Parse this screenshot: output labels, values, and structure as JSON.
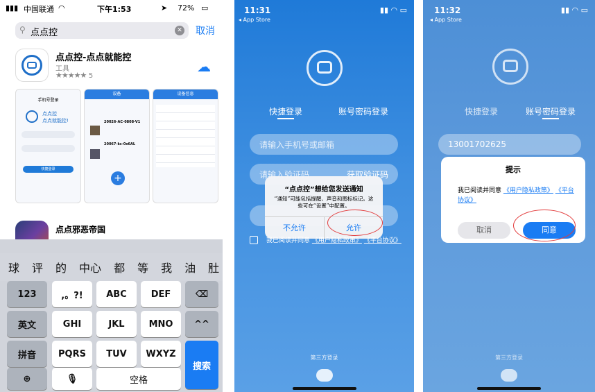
{
  "screen1": {
    "status": {
      "carrier": "中国联通",
      "time": "下午1:53",
      "battery": "72%"
    },
    "search": {
      "query": "点点控",
      "cancel": "取消"
    },
    "app": {
      "name": "点点控-点点就能控",
      "category": "工具",
      "rating_count": "5"
    },
    "app2": {
      "name": "点点邪恶帝国"
    },
    "screenshots": {
      "s1": {
        "title": "手机号登录",
        "logo1": "点点控",
        "logo2": "点点就能控!",
        "button": "快捷登录"
      },
      "s2": {
        "title": "设备",
        "dev1": "20026-AC-0808-V1",
        "dev2": "20067-kc-0x6AL"
      },
      "s3": {
        "title": "设备信息"
      }
    },
    "suggestions": [
      "球",
      "评",
      "的",
      "中心",
      "都",
      "等",
      "我",
      "油",
      "肚"
    ],
    "keys": {
      "r1": [
        "123",
        ",。?!",
        "ABC",
        "DEF"
      ],
      "r2": [
        "英文",
        "GHI",
        "JKL",
        "MNO",
        "^^"
      ],
      "r3": [
        "拼音",
        "PQRS",
        "TUV",
        "WXYZ"
      ],
      "search": "搜索",
      "space": "空格"
    }
  },
  "screen2": {
    "status": {
      "time": "11:31",
      "back": "◂ App Store"
    },
    "tabs": {
      "quick": "快捷登录",
      "account": "账号密码登录"
    },
    "phone_placeholder": "请输入手机号或邮箱",
    "code_placeholder": "请输入验证码",
    "get_code": "获取验证码",
    "alert": {
      "title": "“点点控”想给您发送通知",
      "body": "“通知”可能包括提醒、声音和图标标记。这些可在“设置”中配置。",
      "deny": "不允许",
      "allow": "允许"
    },
    "agree": {
      "prefix": "我已阅读并同意",
      "privacy": "《用户隐私政策》",
      "terms": "《平台协议》"
    },
    "third_party": "第三方登录"
  },
  "screen3": {
    "status": {
      "time": "11:32",
      "back": "◂ App Store"
    },
    "tabs": {
      "quick": "快捷登录",
      "account": "账号密码登录"
    },
    "phone_value": "13001702625",
    "dialog": {
      "title": "提示",
      "body": "我已阅读并同意",
      "privacy": "《用户隐私政策》",
      "terms": "《平台协议》",
      "cancel": "取消",
      "ok": "同意"
    },
    "third_party": "第三方登录"
  },
  "colors": {
    "accent": "#1a7cf3",
    "highlight": "#e23a3a"
  }
}
